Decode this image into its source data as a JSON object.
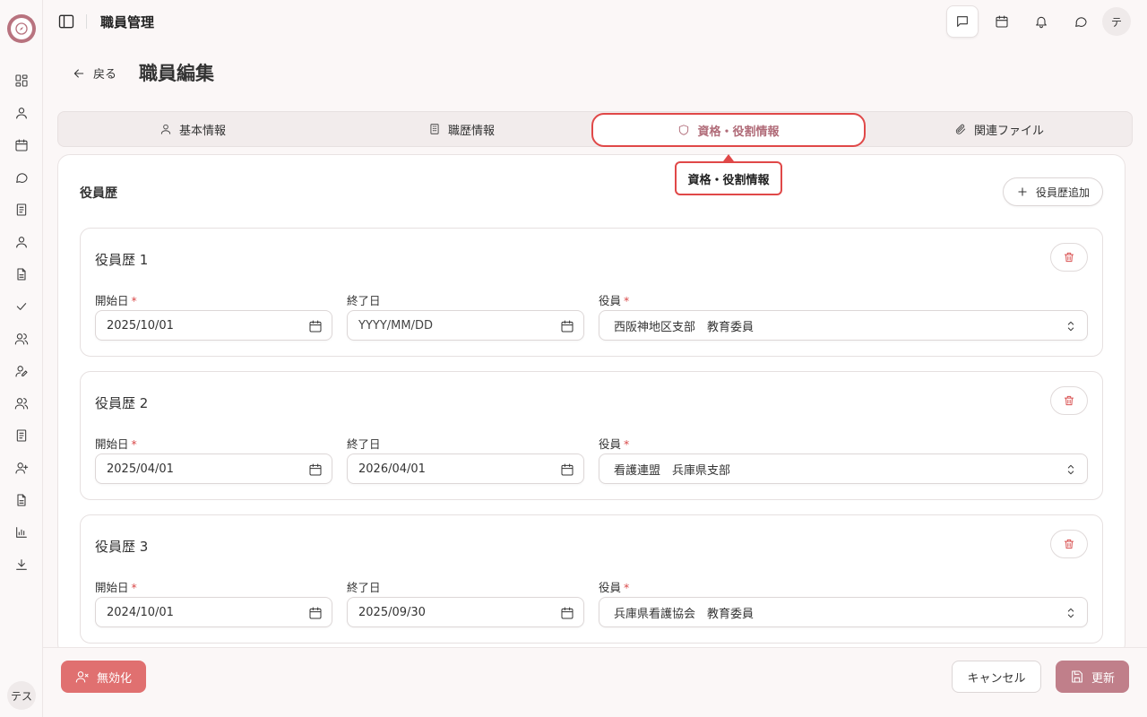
{
  "header": {
    "title": "職員管理",
    "avatar": "テ"
  },
  "sidebar": {
    "avatar": "テス"
  },
  "page": {
    "back_label": "戻る",
    "title": "職員編集"
  },
  "tabs": [
    {
      "label": "基本情報"
    },
    {
      "label": "職歴情報"
    },
    {
      "label": "資格・役割情報"
    },
    {
      "label": "関連ファイル"
    }
  ],
  "tooltip": "資格・役割情報",
  "section": {
    "title": "役員歴",
    "add_label": "役員歴追加"
  },
  "labels": {
    "start": "開始日",
    "end": "終了日",
    "role": "役員",
    "required_mark": "*"
  },
  "entries": [
    {
      "title": "役員歴 1",
      "start": "2025/10/01",
      "end": "YYYY/MM/DD",
      "role": "西阪神地区支部　教育委員"
    },
    {
      "title": "役員歴 2",
      "start": "2025/04/01",
      "end": "2026/04/01",
      "role": "看護連盟　兵庫県支部"
    },
    {
      "title": "役員歴 3",
      "start": "2024/10/01",
      "end": "2025/09/30",
      "role": "兵庫県看護協会　教育委員"
    }
  ],
  "footer": {
    "disable_label": "無効化",
    "cancel_label": "キャンセル",
    "update_label": "更新"
  },
  "colors": {
    "accent": "#c07f8a",
    "danger": "#e07070",
    "highlight": "#e04848"
  }
}
